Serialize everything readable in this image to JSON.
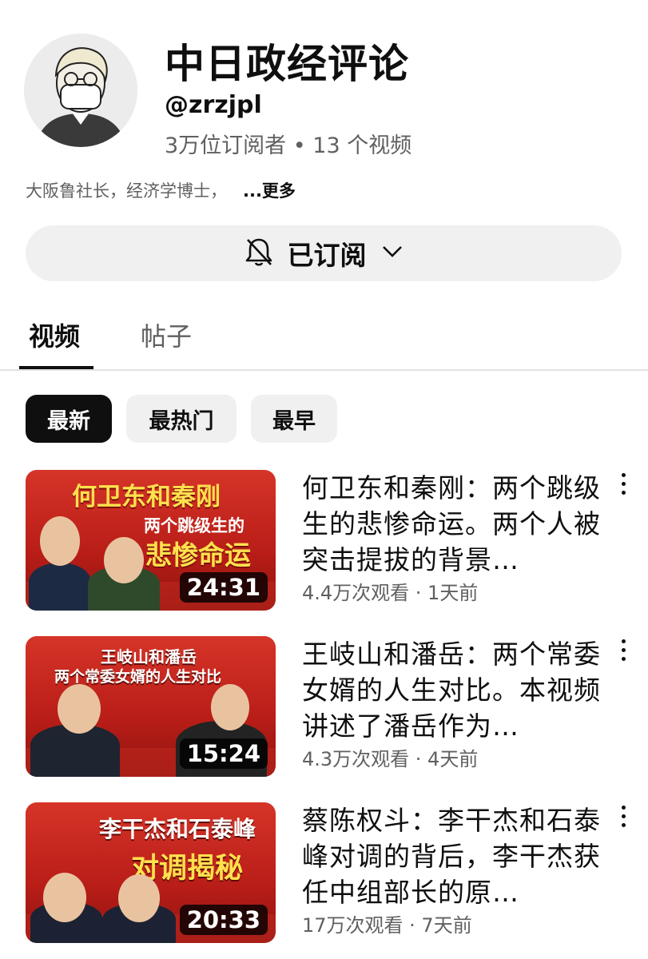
{
  "channel": {
    "title": "中日政经评论",
    "handle": "@zrzjpl",
    "stats": "3万位订阅者 • 13 个视频",
    "description": "大阪鲁社长，经济学博士，",
    "more": "...更多",
    "subscribe_label": "已订阅",
    "bell_icon": "bell-off-icon",
    "chevron_icon": "chevron-down-icon"
  },
  "tabs": [
    "视频",
    "帖子"
  ],
  "chips": [
    "最新",
    "最热门",
    "最早"
  ],
  "videos": [
    {
      "thumb_line1": "何卫东和秦刚",
      "thumb_line2": "两个跳级生的",
      "thumb_line3": "悲惨命运",
      "duration": "24:31",
      "title": "何卫东和秦刚：两个跳级生的悲惨命运。两个人被突击提拔的背景…",
      "meta": "4.4万次观看 · 1天前"
    },
    {
      "thumb_line1": "王岐山和潘岳",
      "thumb_line2": "两个常委女婿的人生对比",
      "thumb_line3": "",
      "duration": "15:24",
      "title": "王岐山和潘岳：两个常委女婿的人生对比。本视频讲述了潘岳作为…",
      "meta": "4.3万次观看 · 4天前"
    },
    {
      "thumb_line1": "李干杰和石泰峰",
      "thumb_line2": "对调揭秘",
      "thumb_line3": "",
      "duration": "20:33",
      "title": "蔡陈权斗：李干杰和石泰峰对调的背后，李干杰获任中组部长的原…",
      "meta": "17万次观看 · 7天前"
    }
  ],
  "colors": {
    "thumb_red": "#c4241c",
    "thumb_yellow": "#ffe14d",
    "chip_active": "#0f0f0f",
    "chip_bg": "#f0f0f0",
    "secondary_text": "#606060"
  }
}
